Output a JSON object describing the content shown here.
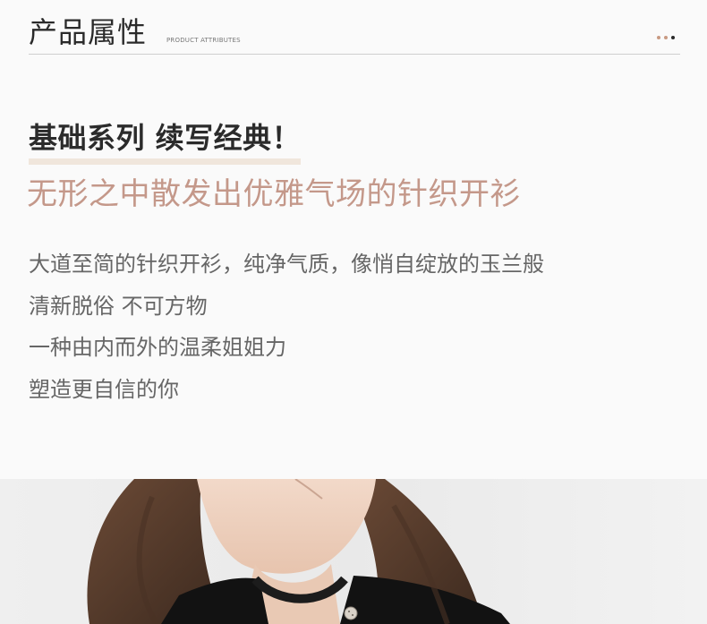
{
  "header": {
    "title": "产品属性",
    "subtitle": "PRODUCT ATTRIBUTES",
    "dot_colors": [
      "#c89a82",
      "#c89a82",
      "#2a2a2a"
    ]
  },
  "headline": "基础系列 续写经典！",
  "subheadline": "无形之中散发出优雅气场的针织开衫",
  "body_lines": [
    "大道至简的针织开衫，纯净气质，像悄自绽放的玉兰般",
    "清新脱俗 不可方物",
    "一种由内而外的温柔姐姐力",
    "塑造更自信的你"
  ],
  "colors": {
    "accent": "#c4988a",
    "headline": "#2b2b2b",
    "body": "#666666",
    "underline": "#f0e6dc"
  }
}
